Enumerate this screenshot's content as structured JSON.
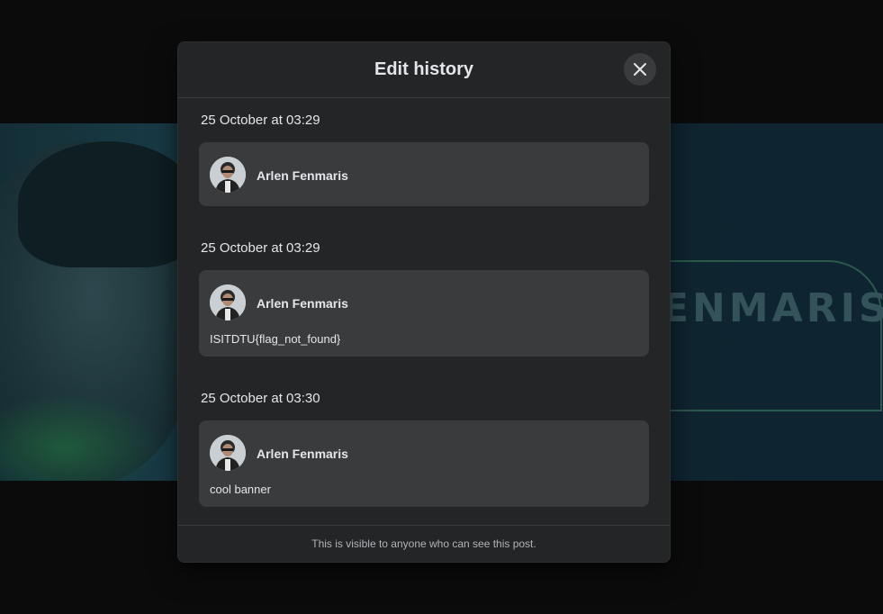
{
  "background": {
    "banner_text": "ENMARIS"
  },
  "modal": {
    "title": "Edit history",
    "close_icon": "close-icon",
    "footer_text": "This is visible to anyone who can see this post."
  },
  "entries": [
    {
      "date": "25 October at 03:29",
      "author": "Arlen Fenmaris",
      "message": ""
    },
    {
      "date": "25 October at 03:29",
      "author": "Arlen Fenmaris",
      "message": "ISITDTU{flag_not_found}"
    },
    {
      "date": "25 October at 03:30",
      "author": "Arlen Fenmaris",
      "message": "cool banner"
    }
  ],
  "colors": {
    "modal_bg": "#242526",
    "card_bg": "#3a3b3c",
    "text_primary": "#e4e6eb",
    "text_secondary": "#b0b3b8"
  }
}
